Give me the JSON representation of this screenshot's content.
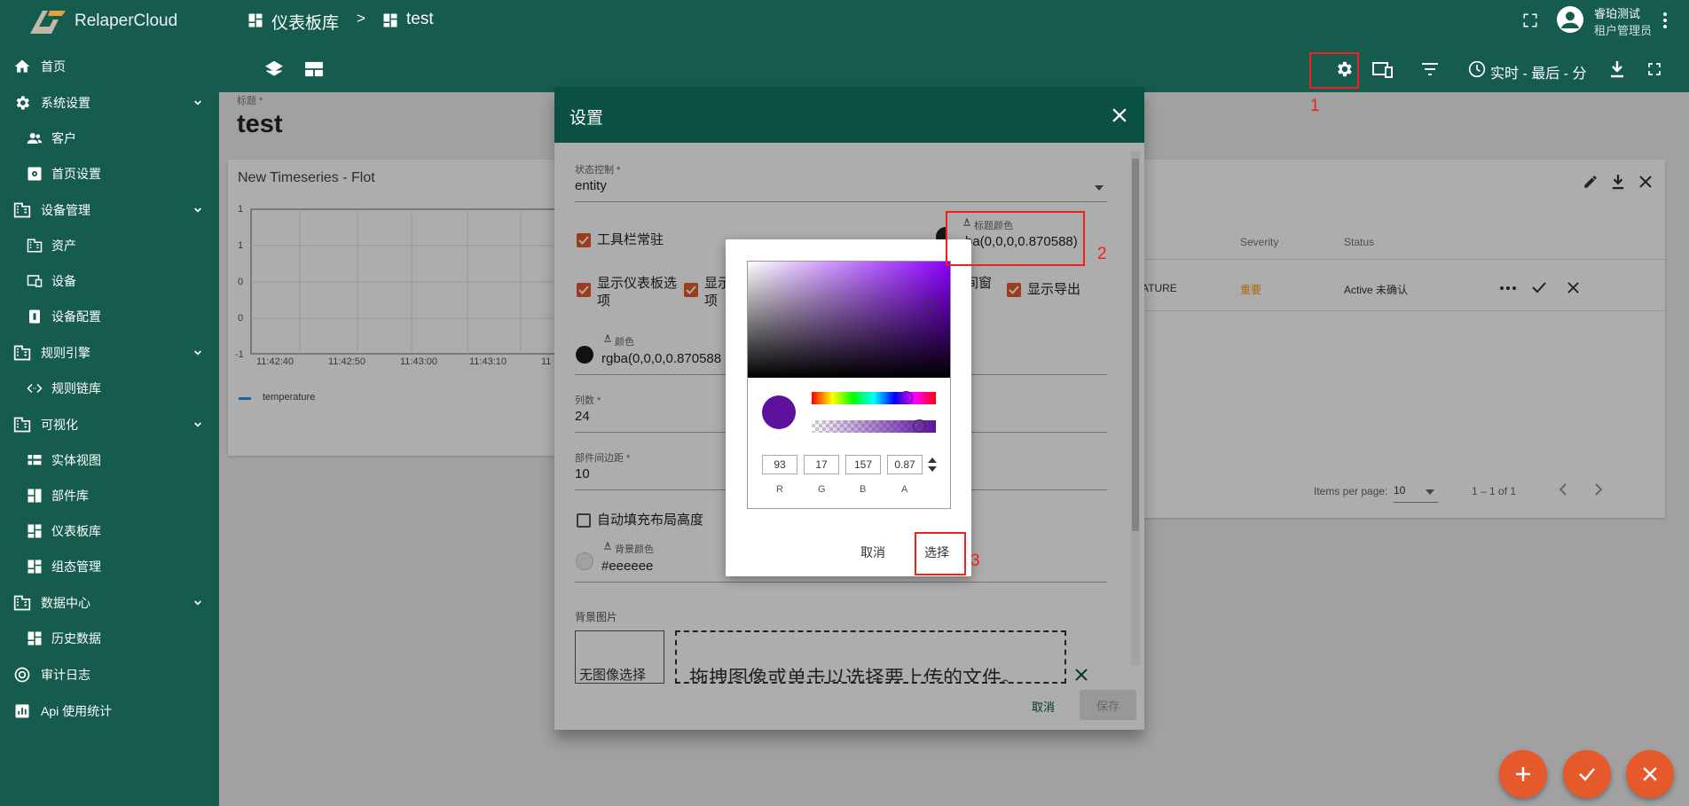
{
  "app": {
    "name": "RelaperCloud"
  },
  "breadcrumb": {
    "parent": "仪表板库",
    "separator": ">",
    "current": "test"
  },
  "user": {
    "name": "睿珀测试",
    "role": "租户管理员"
  },
  "sidebar": {
    "items": [
      {
        "label": "首页",
        "icon": "home-icon"
      },
      {
        "label": "系统设置",
        "icon": "gear-icon"
      },
      {
        "label": "客户",
        "icon": "people-icon"
      },
      {
        "label": "首页设置",
        "icon": "gear-box-icon"
      },
      {
        "label": "设备管理",
        "icon": "building-icon"
      },
      {
        "label": "资产",
        "icon": "building-icon"
      },
      {
        "label": "设备",
        "icon": "devices-icon"
      },
      {
        "label": "设备配置",
        "icon": "device-profile-icon"
      },
      {
        "label": "规则引擎",
        "icon": "building-icon"
      },
      {
        "label": "规则链库",
        "icon": "code-icon"
      },
      {
        "label": "可视化",
        "icon": "building-icon"
      },
      {
        "label": "实体视图",
        "icon": "view-icon"
      },
      {
        "label": "部件库",
        "icon": "widgets-icon"
      },
      {
        "label": "仪表板库",
        "icon": "dashboard-icon"
      },
      {
        "label": "组态管理",
        "icon": "dashboard-icon"
      },
      {
        "label": "数据中心",
        "icon": "building-icon"
      },
      {
        "label": "历史数据",
        "icon": "history-icon"
      },
      {
        "label": "审计日志",
        "icon": "track-icon"
      },
      {
        "label": "Api 使用统计",
        "icon": "chart-icon"
      }
    ]
  },
  "toolbar": {
    "timewindow": "实时 - 最后 - 分"
  },
  "page": {
    "title_label": "标题 *",
    "title": "test"
  },
  "widget": {
    "title": "New Timeseries - Flot",
    "y_ticks": [
      "1",
      "1",
      "0",
      "0",
      "-1"
    ],
    "x_ticks": [
      "11:42:40",
      "11:42:50",
      "11:43:00",
      "11:43:10",
      "11"
    ],
    "legend": "temperature"
  },
  "alarm_widget": {
    "columns": [
      "Severity",
      "Status"
    ],
    "row": {
      "type": "ATURE",
      "severity": "重要",
      "status": "Active 未确认"
    },
    "items_per_page_label": "Items per page:",
    "items_per_page": "10",
    "range": "1 – 1 of 1"
  },
  "dialog": {
    "title": "设置",
    "state_label": "状态控制 *",
    "state_value": "entity",
    "toolbar_fixed": "工具栏常驻",
    "title_color_label": "标题颜色",
    "title_color_value": "ba(0,0,0,0.870588)",
    "show_dashboard_options": "显示仪表板选项",
    "show_partial_1": "显示",
    "show_partial_2": "项",
    "show_window_partial": "间窗",
    "show_export": "显示导出",
    "color_label": "颜色",
    "color_value": "rgba(0,0,0,0.870588",
    "columns_label": "列数 *",
    "columns_value": "24",
    "margin_label": "部件间边距 *",
    "margin_value": "10",
    "autofill": "自动填充布局高度",
    "bg_color_label": "背景颜色",
    "bg_color_value": "#eeeeee",
    "bg_image_label": "背景图片",
    "no_image": "无图像选择",
    "drop_text": "拖拽图像或单击以选择要上传的文件。",
    "cancel": "取消",
    "save": "保存"
  },
  "color_picker": {
    "r": "93",
    "g": "17",
    "b": "157",
    "a": "0.87",
    "r_label": "R",
    "g_label": "G",
    "b_label": "B",
    "a_label": "A",
    "cancel": "取消",
    "select": "选择",
    "hue_color": "#8a00ff",
    "current_color": "#5d119d"
  },
  "annotations": {
    "one": "1",
    "two": "2",
    "three": "3"
  },
  "colors": {
    "primary": "#155b4e",
    "accent": "#e5592b",
    "annotation": "#f02020"
  }
}
